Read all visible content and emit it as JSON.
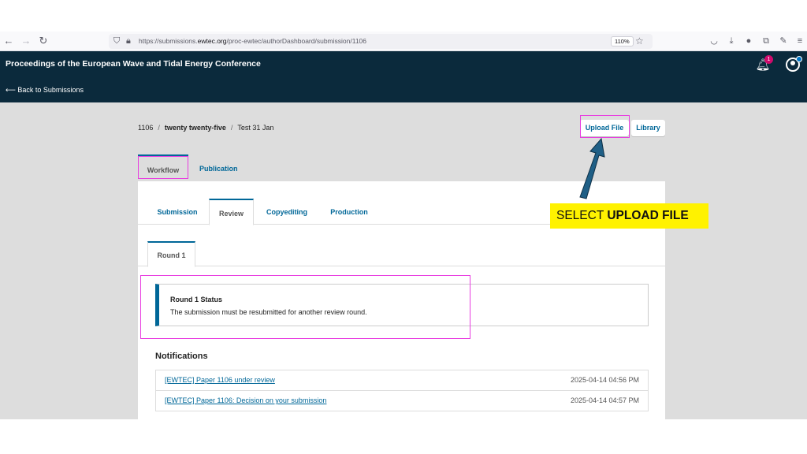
{
  "browser": {
    "url_prefix": "https://submissions.",
    "url_domain": "ewtec.org",
    "url_path": "/proc-ewtec/authorDashboard/submission/1106",
    "zoom": "110%"
  },
  "header": {
    "site_title": "Proceedings of the European Wave and Tidal Energy Conference",
    "back_link": "⟵ Back to Submissions",
    "notification_count": "1"
  },
  "breadcrumb": {
    "id": "1106",
    "section": "twenty twenty-five",
    "title": "Test 31 Jan"
  },
  "actions": {
    "upload_file": "Upload File",
    "library": "Library"
  },
  "main_tabs": {
    "workflow": "Workflow",
    "publication": "Publication"
  },
  "stage_tabs": {
    "submission": "Submission",
    "review": "Review",
    "copyediting": "Copyediting",
    "production": "Production"
  },
  "round_tab": "Round 1",
  "status": {
    "title": "Round 1 Status",
    "text": "The submission must be resubmitted for another review round."
  },
  "notifications": {
    "heading": "Notifications",
    "items": [
      {
        "link": "[EWTEC] Paper 1106 under review",
        "date": "2025-04-14 04:56 PM"
      },
      {
        "link": "[EWTEC] Paper 1106: Decision on your submission",
        "date": "2025-04-14 04:57 PM"
      }
    ]
  },
  "annotation": {
    "prefix": "SELECT ",
    "emphasis": "UPLOAD FILE",
    "highlight_color": "#e83ce0",
    "callout_color": "#fff200",
    "arrow_color": "#1f5f86"
  }
}
